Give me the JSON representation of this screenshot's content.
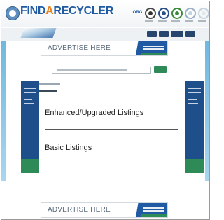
{
  "header": {
    "logo_parts": [
      "FIND",
      "A",
      "RECYCLER"
    ],
    "logo_org": ".ORG",
    "icons": [
      "recycle-circle-icon",
      "blue-circle-icon",
      "green-circle-icon",
      "light-circle-icon",
      "faint-circle-icon"
    ]
  },
  "ads": {
    "top_label": "ADVERTISE HERE",
    "bottom_label": "ADVERTISE HERE"
  },
  "listings": {
    "enhanced_label": "Enhanced/Upgraded Listings",
    "basic_label": "Basic Listings"
  },
  "colors": {
    "brand_blue": "#1f5aa3",
    "brand_orange": "#e8811f",
    "accent_green": "#2e8b57",
    "sidebar_navy": "#1f4f8a"
  }
}
